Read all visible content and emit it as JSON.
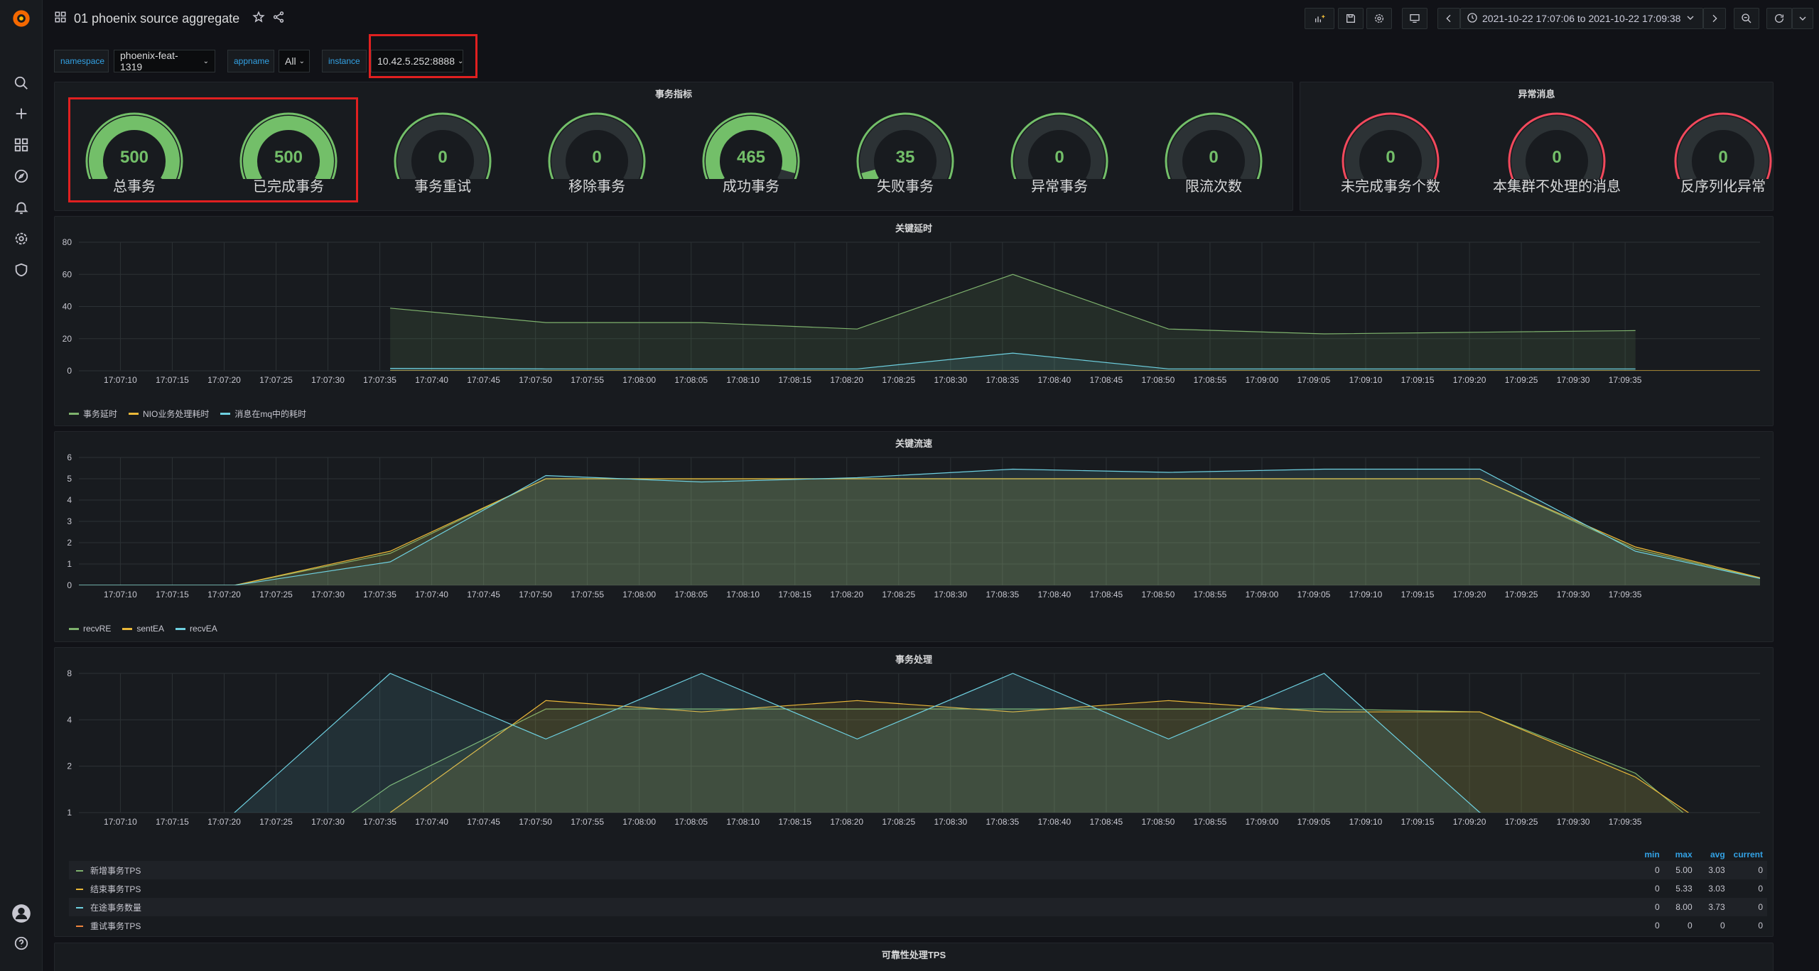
{
  "header": {
    "title": "01 phoenix source aggregate",
    "time_range": "2021-10-22 17:07:06 to 2021-10-22 17:09:38"
  },
  "variables": [
    {
      "label": "namespace",
      "value": "phoenix-feat-1319"
    },
    {
      "label": "appname",
      "value": "All"
    },
    {
      "label": "instance",
      "value": "10.42.5.252:8888"
    }
  ],
  "panels": {
    "tx_metrics": {
      "title": "事务指标",
      "gauges": [
        {
          "label": "总事务",
          "value": "500",
          "fraction": 1.0,
          "color": "#73bf69"
        },
        {
          "label": "已完成事务",
          "value": "500",
          "fraction": 1.0,
          "color": "#73bf69"
        },
        {
          "label": "事务重试",
          "value": "0",
          "fraction": 0.0,
          "color": "#73bf69"
        },
        {
          "label": "移除事务",
          "value": "0",
          "fraction": 0.0,
          "color": "#73bf69"
        },
        {
          "label": "成功事务",
          "value": "465",
          "fraction": 0.93,
          "color": "#73bf69"
        },
        {
          "label": "失败事务",
          "value": "35",
          "fraction": 0.07,
          "color": "#73bf69"
        },
        {
          "label": "异常事务",
          "value": "0",
          "fraction": 0.0,
          "color": "#73bf69"
        },
        {
          "label": "限流次数",
          "value": "0",
          "fraction": 0.0,
          "color": "#73bf69"
        }
      ]
    },
    "anomaly": {
      "title": "异常消息",
      "gauges": [
        {
          "label": "未完成事务个数",
          "value": "0",
          "fraction": 0.0,
          "color": "#73bf69"
        },
        {
          "label": "本集群不处理的消息",
          "value": "0",
          "fraction": 0.0,
          "color": "#73bf69"
        },
        {
          "label": "反序列化异常",
          "value": "0",
          "fraction": 0.0,
          "color": "#73bf69"
        }
      ]
    }
  },
  "time_ticks": [
    "17:07:10",
    "17:07:15",
    "17:07:20",
    "17:07:25",
    "17:07:30",
    "17:07:35",
    "17:07:40",
    "17:07:45",
    "17:07:50",
    "17:07:55",
    "17:08:00",
    "17:08:05",
    "17:08:10",
    "17:08:15",
    "17:08:20",
    "17:08:25",
    "17:08:30",
    "17:08:35",
    "17:08:40",
    "17:08:45",
    "17:08:50",
    "17:08:55",
    "17:09:00",
    "17:09:05",
    "17:09:10",
    "17:09:15",
    "17:09:20",
    "17:09:25",
    "17:09:30",
    "17:09:35"
  ],
  "chart_data": [
    {
      "type": "line",
      "title": "关键延时",
      "x_unit": "seconds since 17:07:06",
      "ylim": [
        0,
        80
      ],
      "yticks": [
        0,
        20,
        40,
        60,
        80
      ],
      "grid": true,
      "legend": "bottom-left",
      "series": [
        {
          "name": "事务延时",
          "color": "#7eb26d",
          "x": [
            30,
            45,
            60,
            75,
            90,
            105,
            120,
            135,
            150
          ],
          "values": [
            39,
            30,
            30,
            26,
            60,
            26,
            23,
            24,
            25
          ]
        },
        {
          "name": "NIO业务处理耗时",
          "color": "#eab839",
          "x": [
            30,
            45,
            60,
            75,
            90,
            105,
            120,
            135,
            150,
            165,
            180
          ],
          "values": [
            0,
            0,
            0,
            0,
            0,
            0,
            0,
            0,
            0,
            0,
            0
          ]
        },
        {
          "name": "消息在mq中的耗时",
          "color": "#6ed0e0",
          "x": [
            30,
            45,
            60,
            75,
            90,
            105,
            120,
            135,
            150
          ],
          "values": [
            1.5,
            1.2,
            1.2,
            1.2,
            11,
            1.2,
            1.2,
            1.2,
            1.2
          ]
        }
      ]
    },
    {
      "type": "area",
      "title": "关键流速",
      "ylim": [
        0,
        6
      ],
      "yticks": [
        0,
        1,
        2,
        3,
        4,
        5,
        6
      ],
      "grid": true,
      "legend": "bottom-left",
      "series": [
        {
          "name": "recvRE",
          "color": "#7eb26d",
          "x": [
            0,
            15,
            30,
            45,
            60,
            75,
            90,
            105,
            120,
            135,
            150,
            165
          ],
          "values": [
            0,
            0,
            1.5,
            5,
            5,
            5,
            5,
            5,
            5,
            5,
            1.7,
            0
          ]
        },
        {
          "name": "sentEA",
          "color": "#eab839",
          "x": [
            0,
            15,
            30,
            45,
            60,
            75,
            90,
            105,
            120,
            135,
            150,
            165
          ],
          "values": [
            0,
            0,
            1.6,
            5,
            5,
            5,
            5,
            5,
            5,
            5,
            1.8,
            0
          ]
        },
        {
          "name": "recvEA",
          "color": "#6ed0e0",
          "x": [
            0,
            15,
            30,
            45,
            60,
            75,
            90,
            105,
            120,
            135,
            150,
            165
          ],
          "values": [
            0,
            0,
            1.1,
            5.15,
            4.85,
            5.05,
            5.45,
            5.3,
            5.45,
            5.45,
            1.6,
            0
          ]
        }
      ]
    },
    {
      "type": "area",
      "title": "事务处理",
      "y_scale": "log2",
      "ylim": [
        1,
        8
      ],
      "yticks": [
        1,
        2,
        4,
        8
      ],
      "grid": true,
      "legend": "table-bottom",
      "legend_columns": [
        "min",
        "max",
        "avg",
        "current"
      ],
      "series": [
        {
          "name": "新增事务TPS",
          "color": "#7eb26d",
          "min": "0",
          "max": "5.00",
          "avg": "3.03",
          "current": "0",
          "x": [
            20,
            30,
            45,
            60,
            75,
            90,
            105,
            120,
            135,
            150,
            160
          ],
          "values": [
            0.5,
            1.5,
            4.7,
            4.7,
            4.7,
            4.7,
            4.7,
            4.7,
            4.5,
            1.8,
            0.5
          ]
        },
        {
          "name": "结束事务TPS",
          "color": "#eab839",
          "min": "0",
          "max": "5.33",
          "avg": "3.03",
          "current": "0",
          "x": [
            30,
            45,
            60,
            75,
            90,
            105,
            120,
            135,
            150,
            160
          ],
          "values": [
            1,
            5.33,
            4.5,
            5.33,
            4.5,
            5.33,
            4.5,
            4.5,
            1.7,
            0.6
          ]
        },
        {
          "name": "在途事务数量",
          "color": "#6ed0e0",
          "min": "0",
          "max": "8.00",
          "avg": "3.73",
          "current": "0",
          "x": [
            10,
            30,
            45,
            60,
            75,
            90,
            105,
            120,
            135,
            150
          ],
          "values": [
            0.5,
            8,
            3,
            8,
            3,
            8,
            3,
            8,
            1,
            0.5
          ]
        },
        {
          "name": "重试事务TPS",
          "color": "#ef843c",
          "min": "0",
          "max": "0",
          "avg": "0",
          "current": "0",
          "x": [],
          "values": []
        }
      ]
    }
  ],
  "next_panel_title": "可靠性处理TPS"
}
